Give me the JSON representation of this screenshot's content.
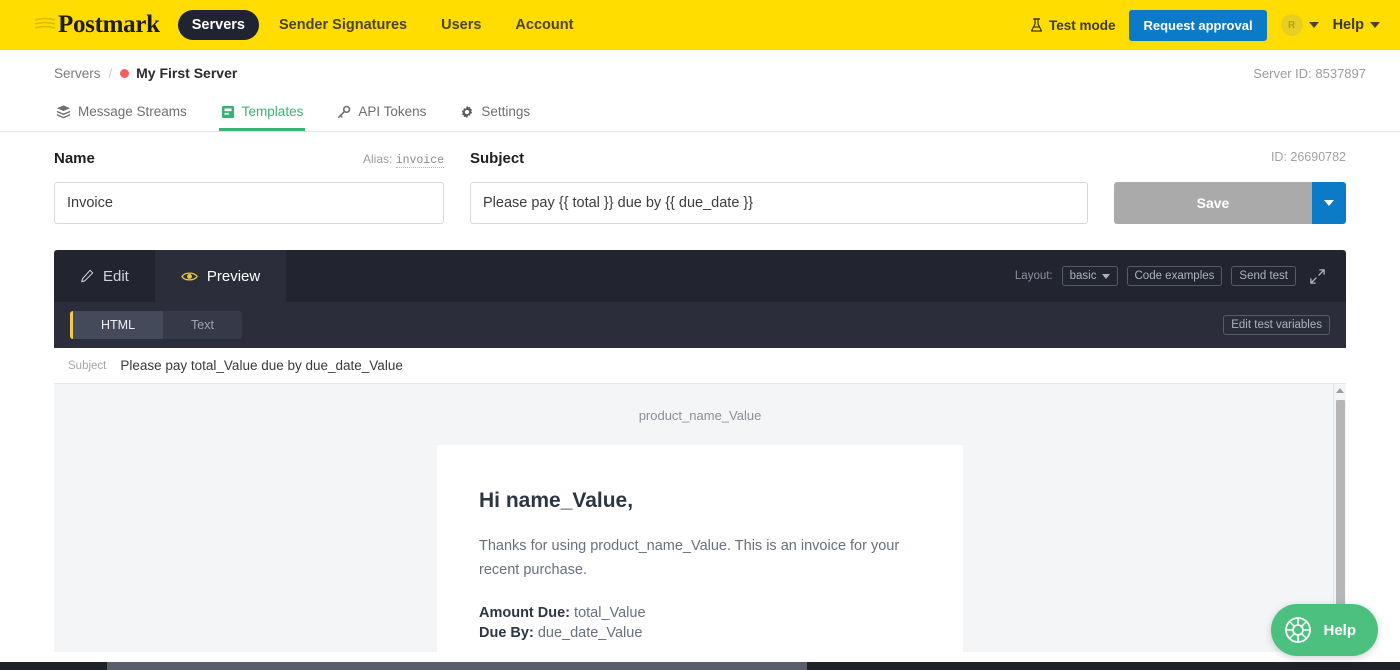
{
  "topnav": {
    "logo": "Postmark",
    "items": [
      {
        "label": "Servers",
        "active": true
      },
      {
        "label": "Sender Signatures",
        "active": false
      },
      {
        "label": "Users",
        "active": false
      },
      {
        "label": "Account",
        "active": false
      }
    ],
    "test_mode_label": "Test mode",
    "test_mode_icon": "flask-icon",
    "request_approval_label": "Request approval",
    "request_approval_color": "#0b7ac7",
    "avatar_initial": "R",
    "help_label": "Help"
  },
  "breadcrumb": {
    "parent": "Servers",
    "separator": "/",
    "current": "My First Server",
    "status_dot_color": "#f1605f",
    "server_id_label": "Server ID: 8537897"
  },
  "subtabs": [
    {
      "label": "Message Streams",
      "icon": "streams-icon",
      "active": false
    },
    {
      "label": "Templates",
      "icon": "template-icon",
      "active": true
    },
    {
      "label": "API Tokens",
      "icon": "key-icon",
      "active": false
    },
    {
      "label": "Settings",
      "icon": "gear-icon",
      "active": false
    }
  ],
  "subtabs_accent": "#3bb273",
  "form": {
    "name_label": "Name",
    "alias_prefix": "Alias:",
    "alias_value": "invoice",
    "name_value": "Invoice",
    "name_placeholder": "Template name",
    "subject_label": "Subject",
    "subject_value": "Please pay {{ total }} due by {{ due_date }}",
    "subject_placeholder": "Subject line",
    "template_id_label": "ID: 26690782",
    "save_label": "Save"
  },
  "panel": {
    "tabs": [
      {
        "label": "Edit",
        "icon": "pencil-icon",
        "active": false
      },
      {
        "label": "Preview",
        "icon": "eye-icon",
        "active": true
      }
    ],
    "layout_label": "Layout:",
    "layout_value": "basic",
    "code_examples_label": "Code examples",
    "send_test_label": "Send test",
    "expand_icon": "expand-icon",
    "format_tabs": [
      {
        "label": "HTML",
        "active": true
      },
      {
        "label": "Text",
        "active": false
      }
    ],
    "edit_test_variables_label": "Edit test variables"
  },
  "preview": {
    "subject_key": "Subject",
    "subject_value": "Please pay total_Value due by due_date_Value",
    "preheader": "product_name_Value",
    "greeting": "Hi name_Value,",
    "body": "Thanks for using product_name_Value. This is an invoice for your recent purchase.",
    "amount_due_label": "Amount Due:",
    "amount_due_value": "total_Value",
    "due_by_label": "Due By:",
    "due_by_value": "due_date_Value"
  },
  "help_widget": {
    "label": "Help",
    "icon": "lifebuoy-icon",
    "color": "#4cc17f"
  }
}
